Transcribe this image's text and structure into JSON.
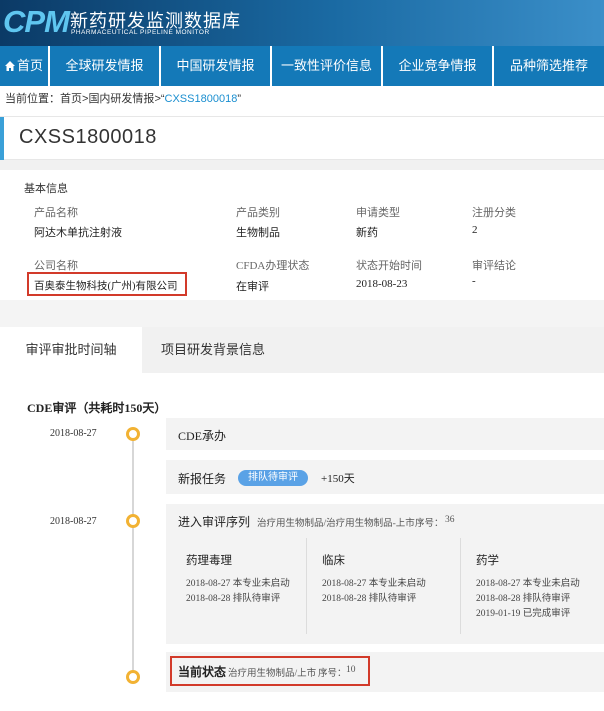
{
  "brand": {
    "logo": "CPM",
    "name_cn": "新药研发监测数据库",
    "name_en": "PHARMACEUTICAL PIPELINE MONITOR"
  },
  "nav": {
    "items": [
      {
        "label": "首页",
        "icon": "home-icon"
      },
      {
        "label": "全球研发情报"
      },
      {
        "label": "中国研发情报"
      },
      {
        "label": "一致性评价信息"
      },
      {
        "label": "企业竞争情报"
      },
      {
        "label": "品种筛选推荐"
      }
    ]
  },
  "breadcrumb": {
    "prefix": "当前位置：",
    "home": "首页",
    "sep": ">",
    "section": "国内研发情报",
    "open_quote": ">“",
    "code": "CXSS1800018",
    "close_quote": "”"
  },
  "page_title": "CXSS1800018",
  "basic_info": {
    "title": "基本信息",
    "fields": {
      "product_name": {
        "label": "产品名称",
        "value": "阿达木单抗注射液"
      },
      "product_category": {
        "label": "产品类别",
        "value": "生物制品"
      },
      "application_type": {
        "label": "申请类型",
        "value": "新药"
      },
      "registration_class": {
        "label": "注册分类",
        "value": "2"
      },
      "company_name": {
        "label": "公司名称",
        "value": "百奥泰生物科技(广州)有限公司"
      },
      "cfda_status": {
        "label": "CFDA办理状态",
        "value": "在审评"
      },
      "review_start": {
        "label": "状态开始时间",
        "value": "2018-08-23"
      },
      "review_conclusion": {
        "label": "审评结论",
        "value": "-"
      }
    }
  },
  "tabs": [
    {
      "label": "审评审批时间轴",
      "active": true
    },
    {
      "label": "项目研发背景信息",
      "active": false
    }
  ],
  "timeline": {
    "title": "CDE审评（共耗时150天）",
    "events": [
      {
        "date": "2018-08-27",
        "title": "CDE承办"
      },
      {
        "title": "新报任务",
        "pill": "排队待审评",
        "extra": "+150天"
      },
      {
        "date": "2018-08-27",
        "title": "进入审评序列",
        "desc": "治疗用生物制品/治疗用生物制品-上市",
        "seq_label": "序号：",
        "seq": "36",
        "columns": [
          {
            "head": "药理毒理",
            "lines": [
              "2018-08-27  本专业未启动",
              "2018-08-28  排队待审评"
            ]
          },
          {
            "head": "临床",
            "lines": [
              "2018-08-27  本专业未启动",
              "2018-08-28  排队待审评"
            ]
          },
          {
            "head": "药学",
            "lines": [
              "2018-08-27  本专业未启动",
              "2018-08-28  排队待审评",
              "2019-01-19  已完成审评"
            ]
          }
        ]
      },
      {
        "title": "当前状态",
        "desc": "治疗用生物制品/上市",
        "seq_label": "序号：",
        "seq": "10"
      }
    ]
  },
  "colors": {
    "header_dark": "#0b3a66",
    "nav_blue": "#1479b8",
    "accent_cyan": "#5fc6f0",
    "highlight_red": "#d23a2a",
    "timeline_dot": "#f2b233",
    "pill_blue": "#5aa2e6"
  }
}
